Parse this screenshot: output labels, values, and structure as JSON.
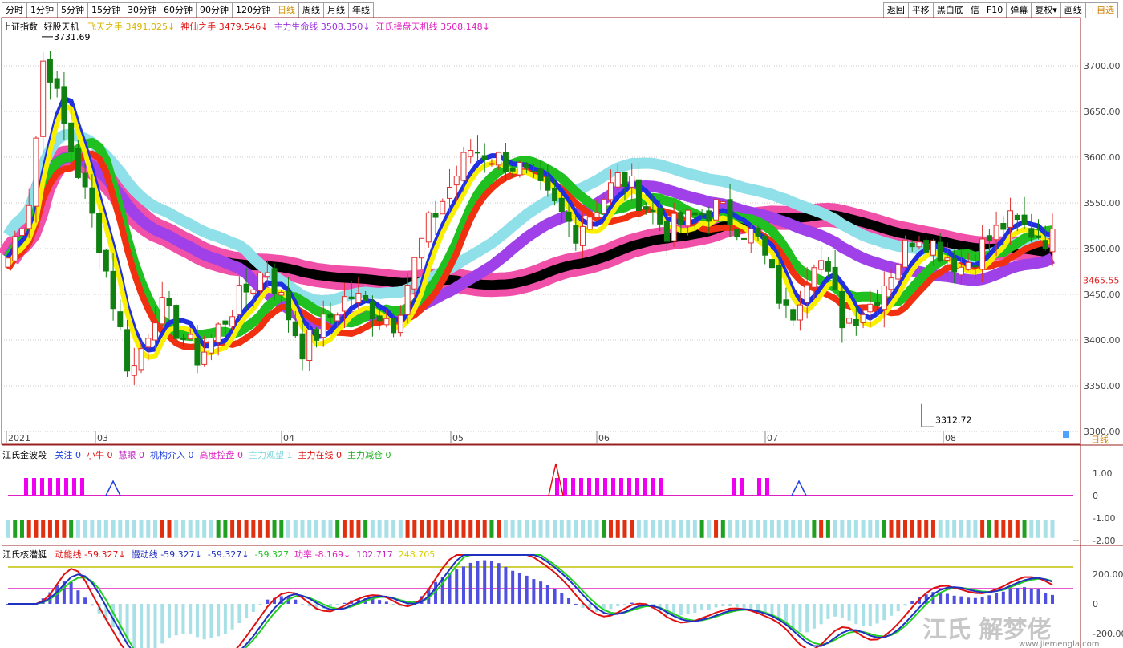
{
  "periods": [
    "分时",
    "1分钟",
    "5分钟",
    "15分钟",
    "30分钟",
    "60分钟",
    "90分钟",
    "120分钟",
    "日线",
    "周线",
    "月线",
    "年线"
  ],
  "active_period": "日线",
  "right_tools": [
    "返回",
    "平移",
    "黑白底",
    "信",
    "F10",
    "弹幕",
    "复权▾",
    "画线",
    "+自选"
  ],
  "main_legend": {
    "symbol": "上证指数",
    "indicator": "好股天机",
    "items": [
      {
        "label": "飞天之手",
        "value": "3491.025↓",
        "color": "#d8b400"
      },
      {
        "label": "神仙之手",
        "value": "3479.546↓",
        "color": "#e01010"
      },
      {
        "label": "主力生命线",
        "value": "3508.350↓",
        "color": "#9b30e0"
      },
      {
        "label": "江氏操盘天机线",
        "value": "3508.148↓",
        "color": "#e020c0"
      }
    ]
  },
  "price_high_label": "3731.69",
  "price_low_label": "3312.72",
  "current_price": "3465.55",
  "y_ticks": [
    "3700.00",
    "3650.00",
    "3600.00",
    "3550.00",
    "3500.00",
    "3450.00",
    "3400.00",
    "3350.00",
    "3300.00"
  ],
  "x_labels": [
    "2021",
    "03",
    "04",
    "05",
    "06",
    "07",
    "08"
  ],
  "period_tag": "日线",
  "wave_legend": {
    "title": "江氏金波段",
    "items": [
      {
        "label": "关注",
        "value": "0",
        "color": "#2040e0"
      },
      {
        "label": "小牛",
        "value": "0",
        "color": "#e01010"
      },
      {
        "label": "慧眼",
        "value": "0",
        "color": "#c020c0"
      },
      {
        "label": "机构介入",
        "value": "0",
        "color": "#2040e0"
      },
      {
        "label": "高度控盘",
        "value": "0",
        "color": "#e020c0"
      },
      {
        "label": "主力观望",
        "value": "1",
        "color": "#80d8e0"
      },
      {
        "label": "主力在线",
        "value": "0",
        "color": "#e01010"
      },
      {
        "label": "主力减仓",
        "value": "0",
        "color": "#20b020"
      }
    ]
  },
  "wave_ticks": [
    "1.00",
    "0",
    "-1.00",
    "-2.00"
  ],
  "osc_legend": {
    "title": "江氏核潜艇",
    "items": [
      {
        "label": "动能线",
        "value": "-59.327↓",
        "color": "#e01010"
      },
      {
        "label": "慢动线",
        "value": "-59.327↓",
        "color": "#2030c0"
      },
      {
        "label": "",
        "value": "-59.327↓",
        "color": "#2030c0"
      },
      {
        "label": "",
        "value": "-59.327",
        "color": "#20c020"
      },
      {
        "label": "功率",
        "value": "-8.169↓",
        "color": "#e020c0"
      },
      {
        "label": "",
        "value": "102.717",
        "color": "#c020c0"
      },
      {
        "label": "",
        "value": "248.705",
        "color": "#d8d000"
      }
    ]
  },
  "osc_ticks": [
    "200.00",
    "0",
    "-200.00"
  ],
  "watermark": "江氏 解梦佬",
  "watermark_url": "www.jiemengla.com"
}
